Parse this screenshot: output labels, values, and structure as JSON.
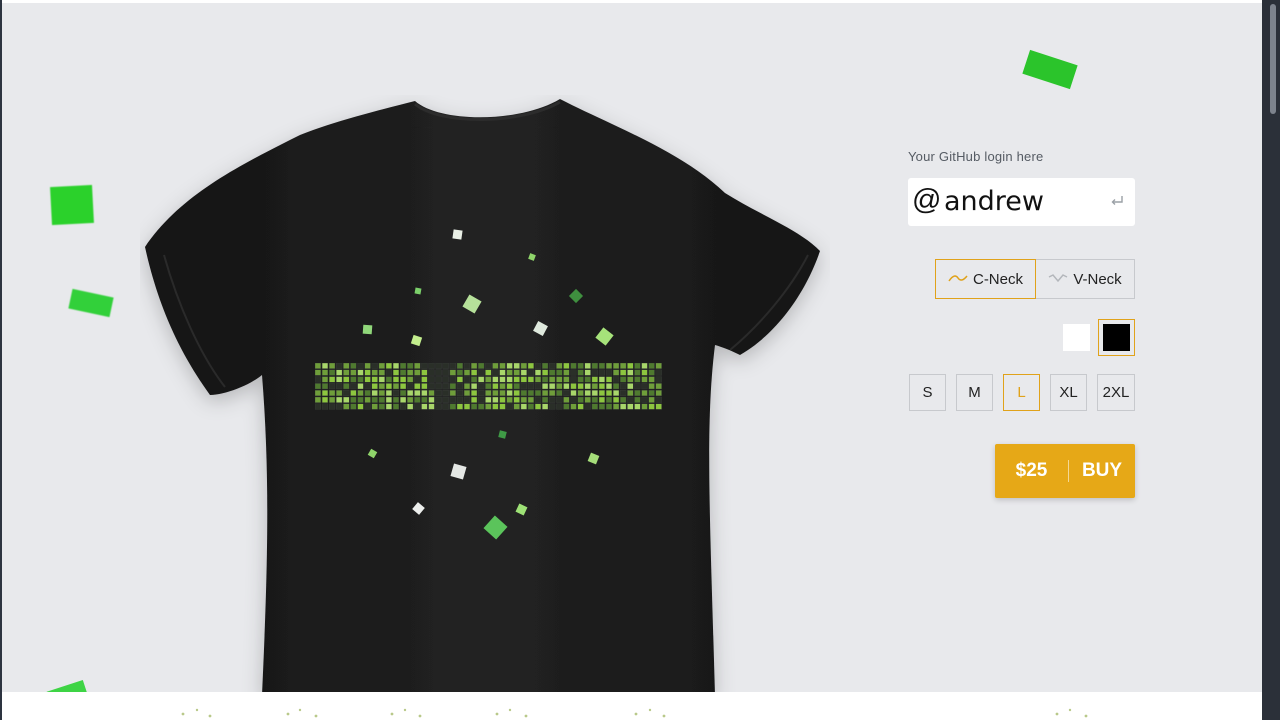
{
  "login": {
    "label": "Your GitHub login here",
    "at_symbol": "@",
    "value": "andrew",
    "enter_icon": "enter-return-icon"
  },
  "neck": {
    "options": [
      "C-Neck",
      "V-Neck"
    ],
    "selected": "C-Neck"
  },
  "colors": {
    "options": [
      "#ffffff",
      "#000000"
    ],
    "selected": "#000000"
  },
  "sizes": {
    "options": [
      "S",
      "M",
      "L",
      "XL",
      "2XL"
    ],
    "selected": "L"
  },
  "buy": {
    "price": "$25",
    "label": "BUY"
  },
  "theme": {
    "accent": "#e6a817",
    "selection_border": "#e0a21a",
    "background": "#e8e9ec",
    "shirt": "#1b1b1b",
    "print_green": "#8dc63f",
    "confetti_green": "#2bd12b"
  }
}
